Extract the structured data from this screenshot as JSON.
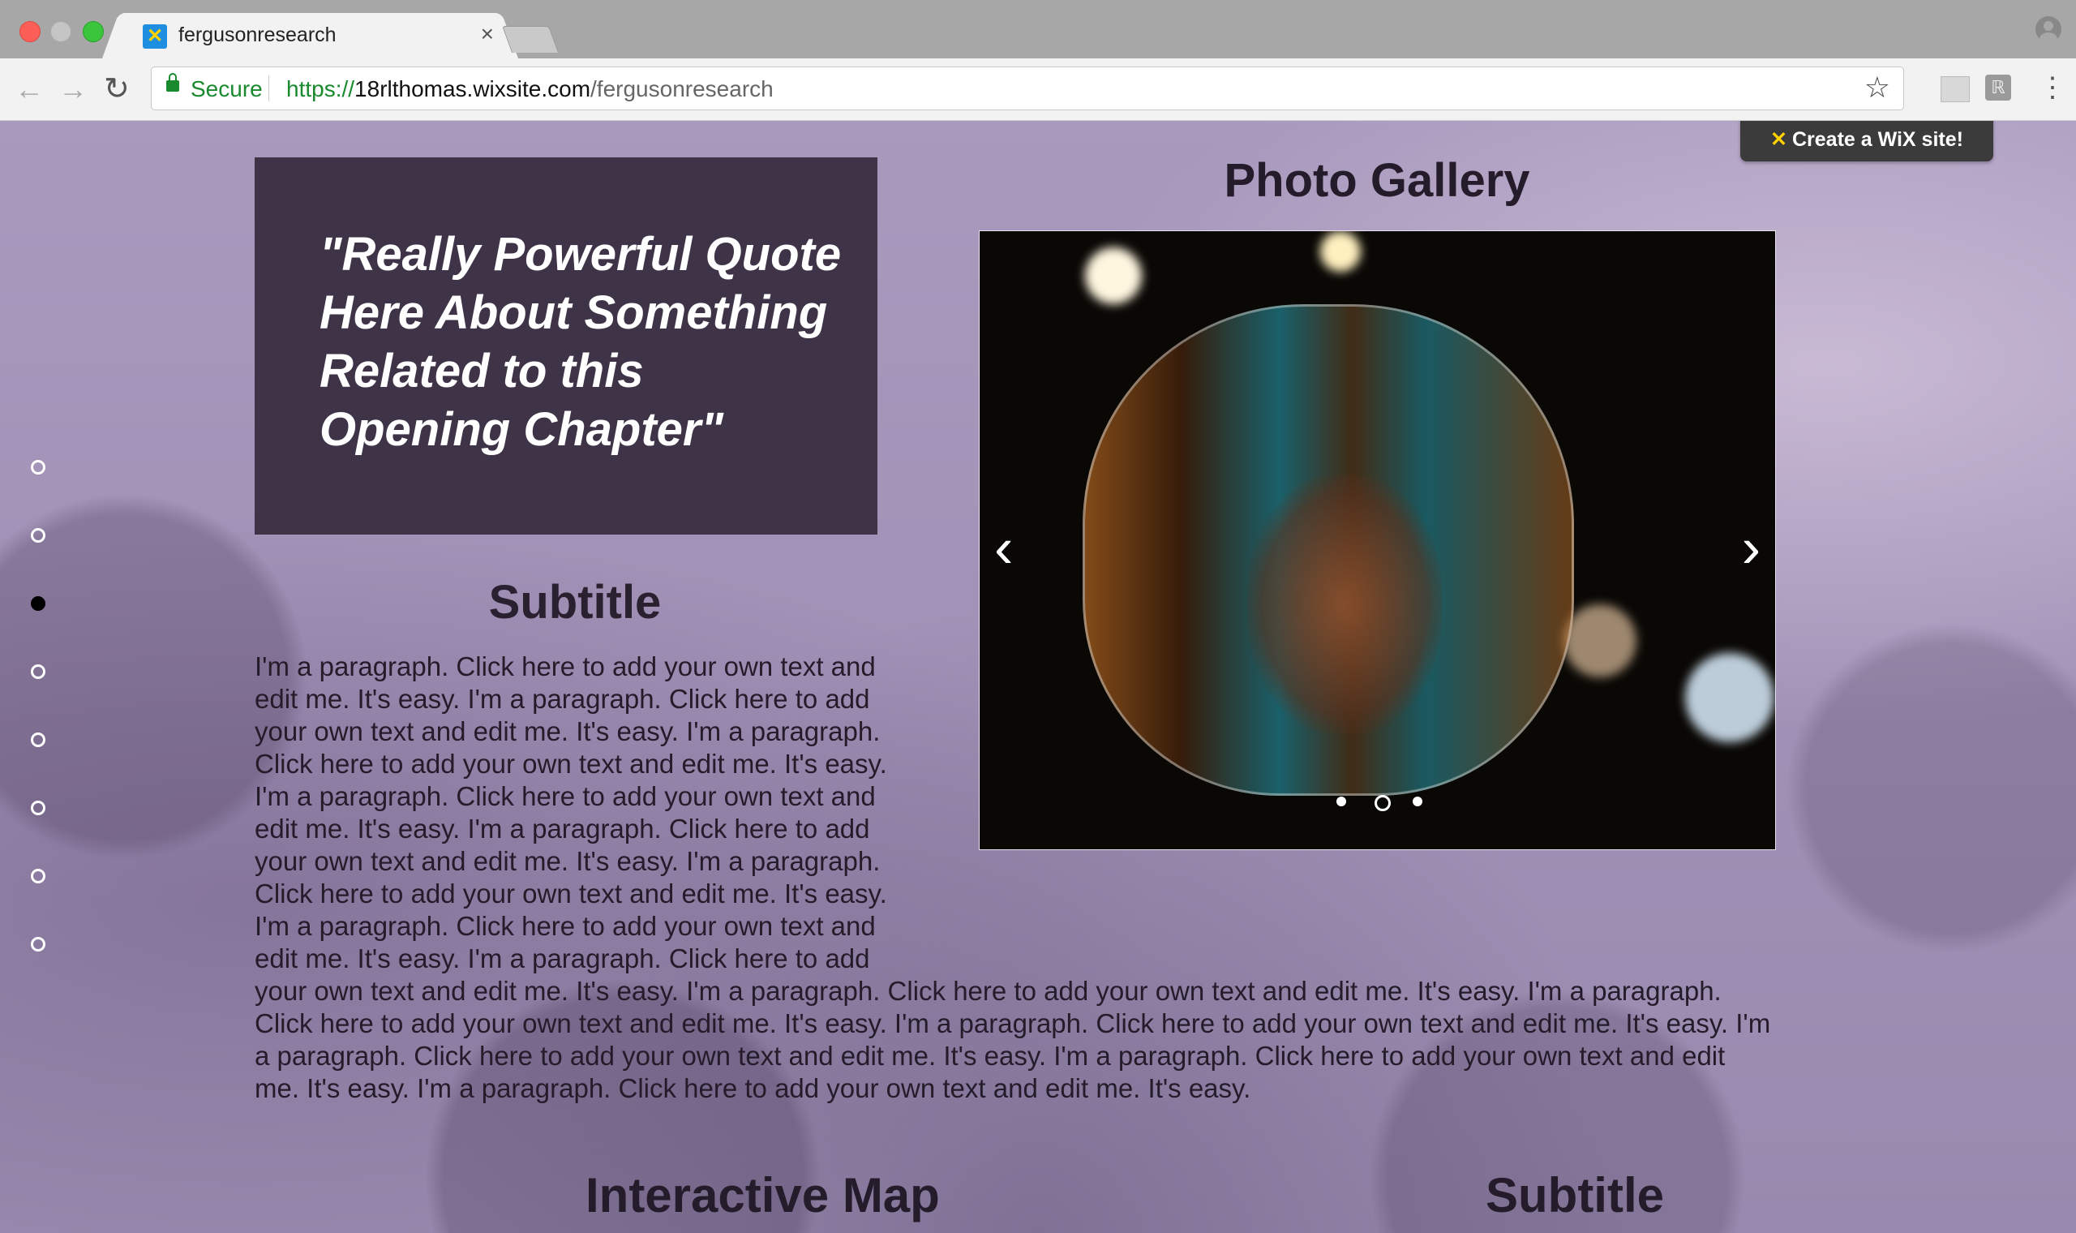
{
  "browser": {
    "tab_title": "fergusonresearch",
    "tab_close": "×",
    "nav": {
      "back": "←",
      "forward": "→",
      "reload": "↻"
    },
    "secure_label": "Secure",
    "url": {
      "scheme": "https://",
      "host": "18rlthomas.wixsite.com",
      "path": "/fergusonresearch"
    },
    "star": "☆",
    "menu": "⋮"
  },
  "wix_banner": {
    "label": "Create a WiX site!"
  },
  "side_nav": {
    "count": 8,
    "active_index": 2
  },
  "quote": {
    "lines": [
      "\"Really Powerful Quote",
      "Here About Something",
      "Related to this",
      "Opening Chapter\""
    ]
  },
  "subtitle_1": "Subtitle",
  "paragraph": "I'm a paragraph. Click here to add your own text and edit me. It's easy. I'm a paragraph. Click here to add your own text and edit me. It's easy. I'm a paragraph. Click here to add your own text and edit me. It's easy. I'm a paragraph. Click here to add your own text and edit me. It's easy. I'm a paragraph. Click here to add your own text and edit me. It's easy. I'm a paragraph. Click here to add your own text and edit me. It's easy. I'm a paragraph. Click here to add your own text and edit me. It's easy. I'm a paragraph. Click here to add your own text and edit me. It's easy. I'm a paragraph. Click here to add your own text and edit me. It's easy. I'm a paragraph. Click here to add your own text and edit me. It's easy. I'm a paragraph. Click here to add your own text and edit me. It's easy. I'm a paragraph. Click here to add your own text and edit me. It's easy. I'm a paragraph. Click here to add your own text and edit me. It's easy. I'm a paragraph. Click here to add your own text and edit me. It's easy.",
  "gallery": {
    "title": "Photo Gallery",
    "prev": "‹",
    "next": "›",
    "slide_count": 3,
    "active_slide": 1
  },
  "bottom": {
    "map_title": "Interactive Map",
    "subtitle_2": "Subtitle"
  }
}
